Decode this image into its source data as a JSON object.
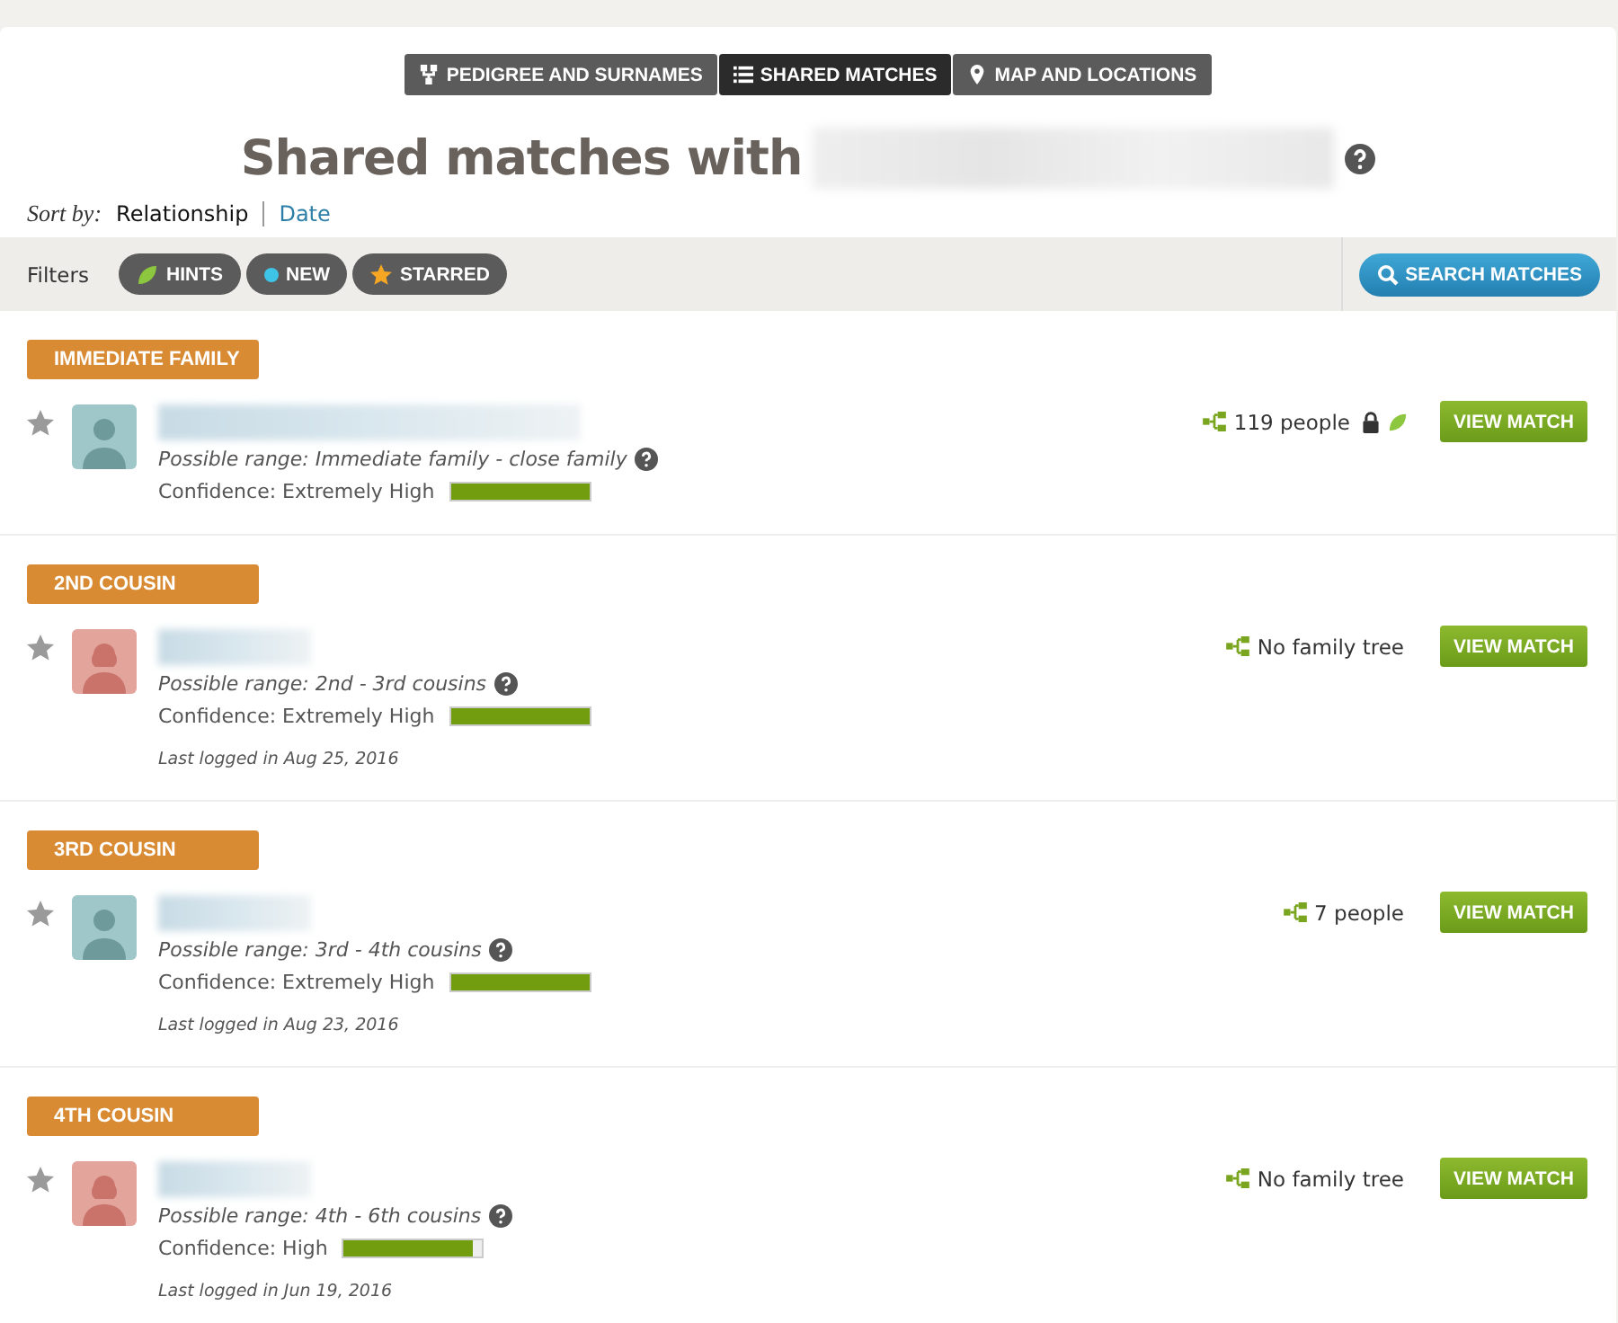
{
  "tabs": [
    {
      "label": "PEDIGREE AND SURNAMES",
      "selected": false
    },
    {
      "label": "SHARED MATCHES",
      "selected": true
    },
    {
      "label": "MAP AND LOCATIONS",
      "selected": false
    }
  ],
  "title": "Shared matches with",
  "sort": {
    "label": "Sort by:",
    "options": [
      {
        "label": "Relationship",
        "selected": true
      },
      {
        "label": "Date",
        "selected": false
      }
    ]
  },
  "filters": {
    "label": "Filters",
    "chips": [
      {
        "label": "HINTS",
        "kind": "hint"
      },
      {
        "label": "NEW",
        "kind": "new"
      },
      {
        "label": "STARRED",
        "kind": "starred"
      }
    ],
    "search_button": "SEARCH MATCHES"
  },
  "groups": [
    {
      "label": "IMMEDIATE FAMILY",
      "matches": [
        {
          "kind": "male",
          "starred": false,
          "range": "Possible range: Immediate family - close family",
          "confidence": "Confidence: Extremely High",
          "level": 1,
          "tree": "119 people",
          "locked": true,
          "hint": true,
          "button": "VIEW MATCH"
        }
      ]
    },
    {
      "label": "2ND COUSIN",
      "matches": [
        {
          "kind": "female",
          "starred": false,
          "range": "Possible range: 2nd - 3rd cousins",
          "confidence": "Confidence: Extremely High",
          "level": 1,
          "last_login": "Last logged in Aug 25, 2016",
          "tree": "No family tree",
          "locked": false,
          "hint": false,
          "button": "VIEW MATCH"
        }
      ]
    },
    {
      "label": "3RD COUSIN",
      "matches": [
        {
          "kind": "male",
          "starred": false,
          "range": "Possible range: 3rd - 4th cousins",
          "confidence": "Confidence: Extremely High",
          "level": 1,
          "last_login": "Last logged in Aug 23, 2016",
          "tree": "7 people",
          "locked": false,
          "hint": false,
          "button": "VIEW MATCH"
        }
      ]
    },
    {
      "label": "4TH COUSIN",
      "matches": [
        {
          "kind": "female",
          "starred": false,
          "range": "Possible range: 4th - 6th cousins",
          "confidence": "Confidence: High",
          "level": 0.93,
          "last_login": "Last logged in Jun 19, 2016",
          "tree": "No family tree",
          "locked": false,
          "hint": false,
          "button": "VIEW MATCH"
        }
      ]
    }
  ]
}
